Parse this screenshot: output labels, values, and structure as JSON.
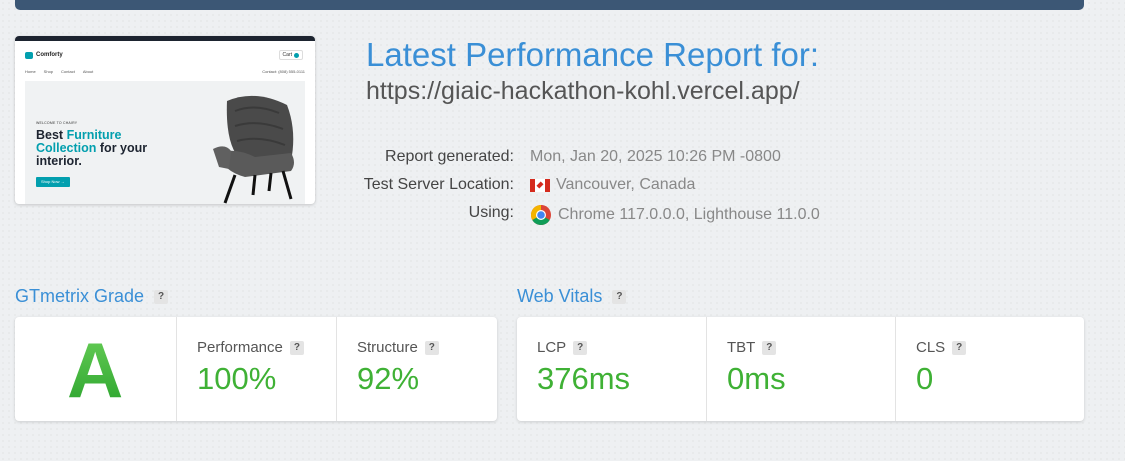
{
  "report": {
    "title": "Latest Performance Report for:",
    "url": "https://giaic-hackathon-kohl.vercel.app/"
  },
  "thumbnail": {
    "logo": "Comforty",
    "cart": "Cart",
    "menu": [
      "Home",
      "Shop",
      "Contact",
      "About"
    ],
    "contact": "Contact: (808) 555-0111",
    "welcome": "WELCOME TO CHAIRY",
    "heading_1": "Best ",
    "heading_2": "Furniture",
    "heading_3": "Collection",
    "heading_4": " for your",
    "heading_5": "interior.",
    "cta": "Shop Now →"
  },
  "meta": {
    "generated_label": "Report generated:",
    "generated_value": "Mon, Jan 20, 2025 10:26 PM -0800",
    "location_label": "Test Server Location:",
    "location_value": "Vancouver, Canada",
    "using_label": "Using:",
    "using_value": "Chrome 117.0.0.0, Lighthouse 11.0.0"
  },
  "grade_section": {
    "title": "GTmetrix Grade",
    "help": "?",
    "grade": "A",
    "performance_label": "Performance",
    "performance_value": "100%",
    "structure_label": "Structure",
    "structure_value": "92%"
  },
  "vitals_section": {
    "title": "Web Vitals",
    "help": "?",
    "lcp_label": "LCP",
    "lcp_value": "376ms",
    "tbt_label": "TBT",
    "tbt_value": "0ms",
    "cls_label": "CLS",
    "cls_value": "0"
  },
  "colors": {
    "accent": "#3a8fd6",
    "good": "#3fb135",
    "topbar": "#3c5775"
  }
}
